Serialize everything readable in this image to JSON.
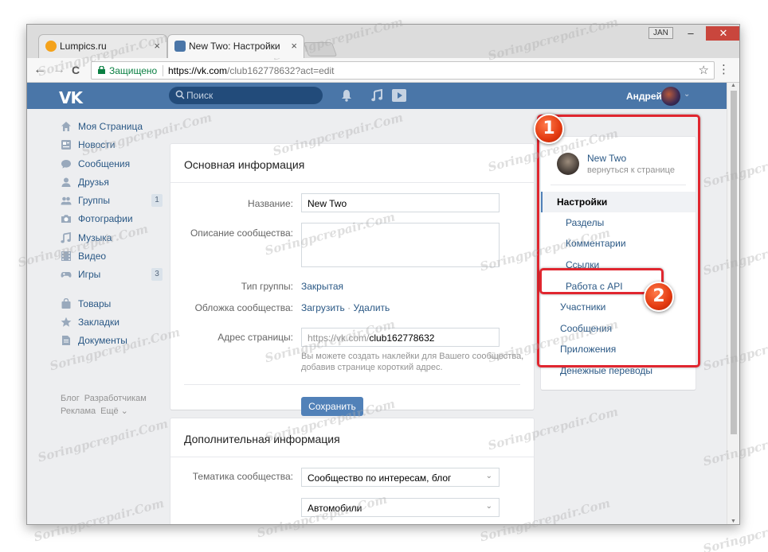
{
  "browser": {
    "tabs": [
      {
        "label": "Lumpics.ru",
        "close": "×"
      },
      {
        "label": "New Two: Настройки",
        "close": "×"
      }
    ],
    "jan_label": "JAN",
    "minimize": "–",
    "maximize": "☐",
    "close": "✕",
    "secure_label": "Защищено",
    "url_host": "https://vk.com",
    "url_rest": "/club162778632?act=edit",
    "back": "←",
    "forward": "→",
    "reload": "C",
    "bookmark": "☆",
    "menu": "⋮"
  },
  "vk_header": {
    "logo": "VK",
    "search_placeholder": "Поиск",
    "user_name": "Андрей",
    "chev": "⌄"
  },
  "left_menu": {
    "items": [
      {
        "label": "Моя Страница",
        "icon": "home-icon"
      },
      {
        "label": "Новости",
        "icon": "news-icon"
      },
      {
        "label": "Сообщения",
        "icon": "messages-icon"
      },
      {
        "label": "Друзья",
        "icon": "friends-icon"
      },
      {
        "label": "Группы",
        "icon": "groups-icon",
        "badge": "1"
      },
      {
        "label": "Фотографии",
        "icon": "camera-icon"
      },
      {
        "label": "Музыка",
        "icon": "music-icon"
      },
      {
        "label": "Видео",
        "icon": "video-icon"
      },
      {
        "label": "Игры",
        "icon": "games-icon",
        "badge": "3"
      }
    ],
    "items2": [
      {
        "label": "Товары",
        "icon": "bag-icon"
      },
      {
        "label": "Закладки",
        "icon": "star-icon"
      },
      {
        "label": "Документы",
        "icon": "document-icon"
      }
    ],
    "footer": [
      "Блог",
      "Разработчикам",
      "Реклама",
      "Ещё ⌄"
    ]
  },
  "main": {
    "basic_title": "Основная информация",
    "name_label": "Название:",
    "name_value": "New Two",
    "description_label": "Описание сообщества:",
    "type_label": "Тип группы:",
    "type_value": "Закрытая",
    "cover_label": "Обложка сообщества:",
    "cover_upload": "Загрузить",
    "cover_delete": "Удалить",
    "address_label": "Адрес страницы:",
    "address_prefix": "https://vk.com/",
    "address_value": "club162778632",
    "address_hint": "Вы можете создать наклейки для Вашего сообщества, добавив странице короткий адрес.",
    "save": "Сохранить",
    "extra_title": "Дополнительная информация",
    "topic_label": "Тематика сообщества:",
    "topic_value": "Сообщество по интересам, блог",
    "subtopic_value": "Автомобили",
    "select_chev": "⌄"
  },
  "right_menu": {
    "group_name": "New Two",
    "back_link": "вернуться к странице",
    "items": [
      "Настройки",
      "Разделы",
      "Комментарии",
      "Ссылки",
      "Работа с API",
      "Участники",
      "Сообщения",
      "Приложения",
      "Денежные переводы"
    ]
  },
  "annotations": {
    "step1": "1",
    "step2": "2"
  },
  "watermark": "Soringpcrepair.Com",
  "colors": {
    "vk_blue": "#4a76a8",
    "link": "#2a5885",
    "button": "#5181b8",
    "annotation_red": "#e0262f",
    "badge_orange": "#e33a10"
  }
}
